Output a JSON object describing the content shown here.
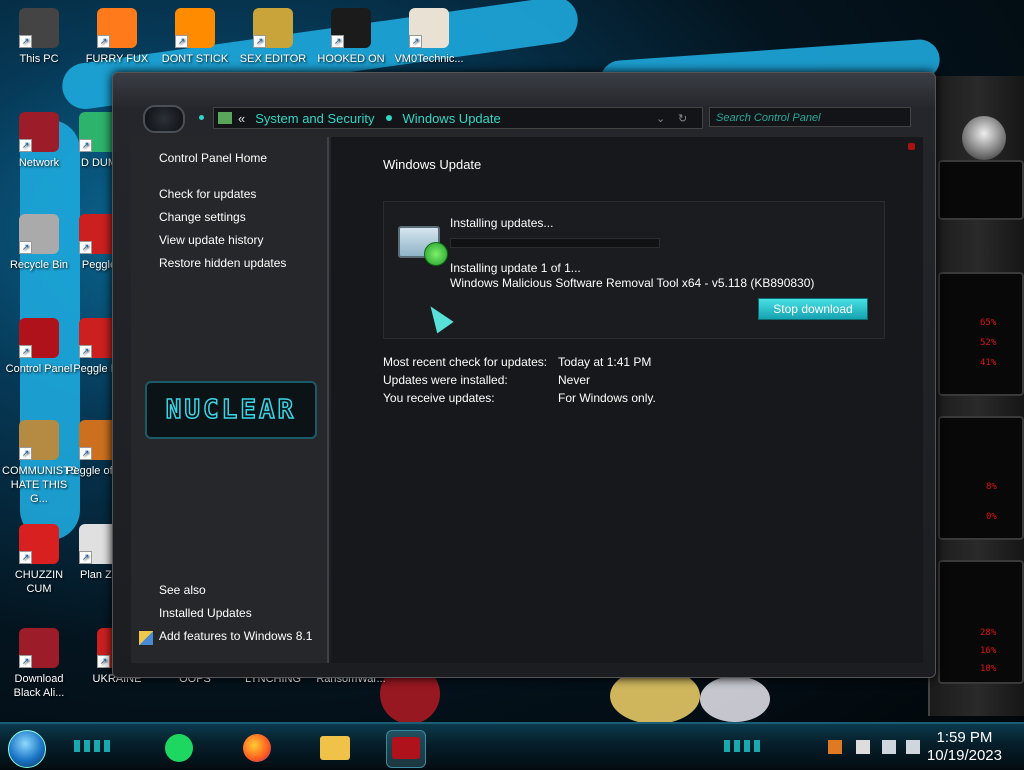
{
  "desktop": {
    "icons": [
      {
        "label": "This PC",
        "color": "#444"
      },
      {
        "label": "FURRY FUX",
        "color": "#ff7a1a"
      },
      {
        "label": "DONT STICK",
        "color": "#ff8c00"
      },
      {
        "label": "SEX EDITOR",
        "color": "#c8a43a"
      },
      {
        "label": "HOOKED ON",
        "color": "#1b1b1b"
      },
      {
        "label": "VM0Technic...",
        "color": "#e9e2d4"
      },
      {
        "label": "Network",
        "color": "#9c1c2a"
      },
      {
        "label": "D DUM",
        "color": "#2db36b"
      },
      {
        "label": "Recycle Bin",
        "color": "#aaa"
      },
      {
        "label": "Peggle",
        "color": "#cc2020"
      },
      {
        "label": "Control Panel",
        "color": "#b0121c"
      },
      {
        "label": "Peggle De",
        "color": "#cc2020"
      },
      {
        "label": "COMMUNISTS HATE THIS G...",
        "color": "#b58a43"
      },
      {
        "label": "Peggle of Wa",
        "color": "#cc7020"
      },
      {
        "label": "CHUZZIN CUM",
        "color": "#d82020"
      },
      {
        "label": "Plan Zo",
        "color": "#e0e0e0"
      },
      {
        "label": "Download Black Ali...",
        "color": "#9c1c2a"
      },
      {
        "label": "UKRAINE",
        "color": "#cc2020"
      },
      {
        "label": "OOPS",
        "color": "#222"
      },
      {
        "label": "LYNCHING",
        "color": "#222"
      },
      {
        "label": "RansomWar...",
        "color": "#222"
      }
    ]
  },
  "address_bar": {
    "back_icon": "double-chevron-left-icon",
    "crumbs": [
      "System and Security",
      "Windows Update"
    ],
    "search_placeholder": "Search Control Panel"
  },
  "left_pane": {
    "home": "Control Panel Home",
    "links": [
      "Check for updates",
      "Change settings",
      "View update history",
      "Restore hidden updates"
    ],
    "logo_text": "NUCLEAR",
    "see_also": "See also",
    "see_also_links": [
      "Installed Updates",
      "Add features to Windows 8.1"
    ]
  },
  "content": {
    "title": "Windows Update",
    "status": "Installing updates...",
    "progress": 0.0,
    "installing_line": "Installing update 1 of 1...",
    "update_name": "Windows Malicious Software Removal Tool x64 - v5.118 (KB890830)",
    "stop_button": "Stop download",
    "info": [
      {
        "label": "Most recent check for updates:",
        "value": "Today at 1:41 PM"
      },
      {
        "label": "Updates were installed:",
        "value": "Never"
      },
      {
        "label": "You receive updates:",
        "value": "For Windows only."
      }
    ]
  },
  "right_widget": {
    "readouts": [
      "65%",
      "52%",
      "41%",
      "8%",
      "0%",
      "28%",
      "16%",
      "10%"
    ]
  },
  "taskbar": {
    "time": "1:59 PM",
    "date": "10/19/2023"
  },
  "colors": {
    "accent": "#30d6c6",
    "button": "#1fb3bf",
    "warning_red": "#dd1111"
  }
}
